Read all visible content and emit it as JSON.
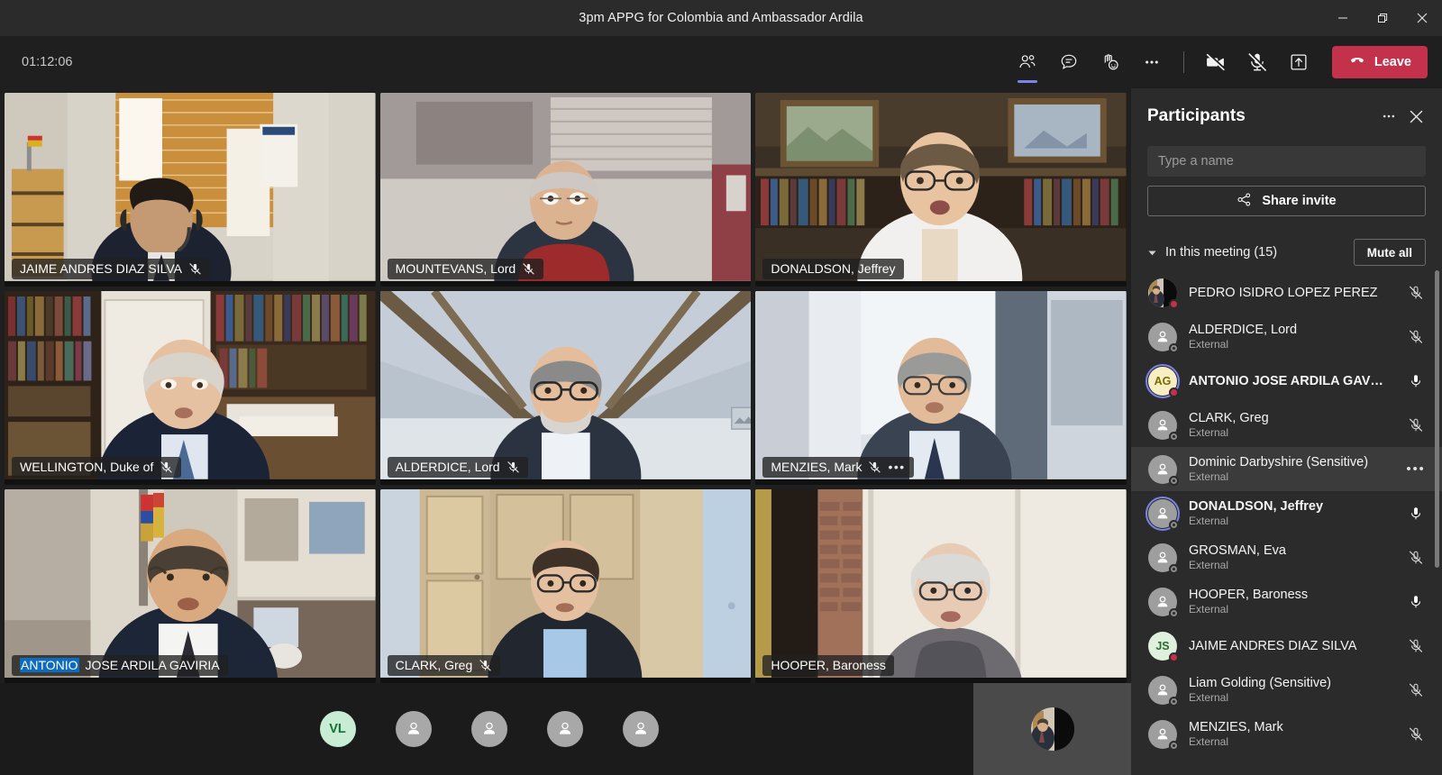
{
  "window": {
    "title": "3pm APPG for Colombia and Ambassador Ardila",
    "minimize_label": "Minimize",
    "restore_label": "Restore",
    "close_label": "Close"
  },
  "toolbar": {
    "timer": "01:12:06",
    "people_label": "Show participants",
    "chat_label": "Show conversation",
    "reactions_label": "Reactions",
    "more_label": "More actions",
    "camera_label": "Turn camera on",
    "mic_label": "Unmute",
    "share_label": "Share content",
    "leave_label": "Leave",
    "leave_color": "#c4314b",
    "accent_color": "#7b83eb"
  },
  "grid": {
    "tiles": [
      {
        "name": "JAIME ANDRES DIAZ SILVA",
        "muted": true,
        "highlight": "",
        "more": false
      },
      {
        "name": "MOUNTEVANS, Lord",
        "muted": true,
        "highlight": "",
        "more": false
      },
      {
        "name": "DONALDSON, Jeffrey",
        "muted": false,
        "highlight": "",
        "more": false
      },
      {
        "name": "WELLINGTON, Duke of",
        "muted": true,
        "highlight": "",
        "more": false
      },
      {
        "name": "ALDERDICE, Lord",
        "muted": true,
        "highlight": "",
        "more": false
      },
      {
        "name": "MENZIES, Mark",
        "muted": true,
        "highlight": "",
        "more": true
      },
      {
        "name": "JOSE ARDILA GAVIRIA",
        "muted": false,
        "highlight": "ANTONIO",
        "more": false
      },
      {
        "name": "CLARK, Greg",
        "muted": true,
        "highlight": "",
        "more": false
      },
      {
        "name": "HOOPER, Baroness",
        "muted": false,
        "highlight": "",
        "more": false
      }
    ]
  },
  "overflow": {
    "avatars": [
      {
        "initials": "VL",
        "type": "initials"
      },
      {
        "initials": "",
        "type": "generic"
      },
      {
        "initials": "",
        "type": "generic"
      },
      {
        "initials": "",
        "type": "generic"
      },
      {
        "initials": "",
        "type": "generic"
      }
    ]
  },
  "panel": {
    "title": "Participants",
    "more_label": "More options",
    "close_label": "Close participants panel",
    "search_placeholder": "Type a name",
    "search_value": "",
    "share_invite_label": "Share invite",
    "section_label": "In this meeting (15)",
    "mute_all_label": "Mute all",
    "participants": [
      {
        "name": "PEDRO ISIDRO LOPEZ PEREZ",
        "sub": "",
        "avatar": "photo",
        "presence": "busy",
        "mic": "muted",
        "speaking": false,
        "hovered": false,
        "bold": false
      },
      {
        "name": "ALDERDICE, Lord",
        "sub": "External",
        "avatar": "generic",
        "presence": "offline",
        "mic": "muted",
        "speaking": false,
        "hovered": false,
        "bold": false
      },
      {
        "name": "ANTONIO JOSE ARDILA GAV…",
        "sub": "",
        "avatar": "AG",
        "presence": "busy",
        "mic": "unmuted",
        "speaking": true,
        "hovered": false,
        "bold": true
      },
      {
        "name": "CLARK, Greg",
        "sub": "External",
        "avatar": "generic",
        "presence": "offline",
        "mic": "muted",
        "speaking": false,
        "hovered": false,
        "bold": false
      },
      {
        "name": "Dominic Darbyshire (Sensitive)",
        "sub": "External",
        "avatar": "generic",
        "presence": "offline",
        "mic": "more",
        "speaking": false,
        "hovered": true,
        "bold": false
      },
      {
        "name": "DONALDSON, Jeffrey",
        "sub": "External",
        "avatar": "generic",
        "presence": "offline",
        "mic": "unmuted",
        "speaking": true,
        "hovered": false,
        "bold": true
      },
      {
        "name": "GROSMAN, Eva",
        "sub": "External",
        "avatar": "generic",
        "presence": "offline",
        "mic": "muted",
        "speaking": false,
        "hovered": false,
        "bold": false
      },
      {
        "name": "HOOPER, Baroness",
        "sub": "External",
        "avatar": "generic",
        "presence": "offline",
        "mic": "unmuted",
        "speaking": false,
        "hovered": false,
        "bold": false
      },
      {
        "name": "JAIME ANDRES DIAZ SILVA",
        "sub": "",
        "avatar": "JS",
        "presence": "busy",
        "mic": "muted",
        "speaking": false,
        "hovered": false,
        "bold": false
      },
      {
        "name": "Liam Golding (Sensitive)",
        "sub": "External",
        "avatar": "generic",
        "presence": "offline",
        "mic": "muted",
        "speaking": false,
        "hovered": false,
        "bold": false
      },
      {
        "name": "MENZIES, Mark",
        "sub": "External",
        "avatar": "generic",
        "presence": "offline",
        "mic": "muted",
        "speaking": false,
        "hovered": false,
        "bold": false
      }
    ]
  }
}
